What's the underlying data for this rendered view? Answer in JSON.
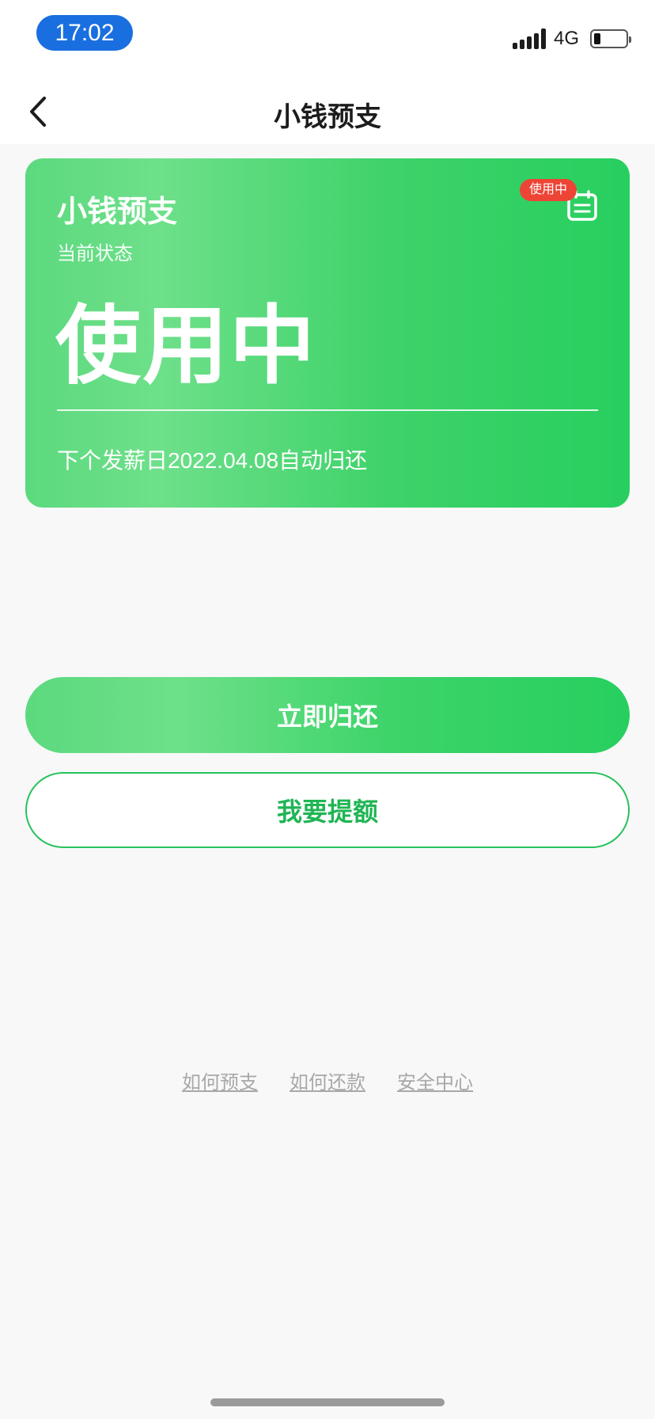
{
  "status_bar": {
    "time": "17:02",
    "network": "4G",
    "battery_level": 0.2
  },
  "nav": {
    "back_icon": "chevron-left-icon",
    "title": "小钱预支"
  },
  "card": {
    "title": "小钱预支",
    "subtitle": "当前状态",
    "status": "使用中",
    "badge": "使用中",
    "icon": "calendar-icon",
    "note": "下个发薪日2022.04.08自动归还",
    "gradient_colors": [
      "#6ee08a",
      "#27cf5f"
    ]
  },
  "actions": {
    "primary_label": "立即归还",
    "secondary_label": "我要提额"
  },
  "footer": {
    "links": [
      {
        "label": "如何预支"
      },
      {
        "label": "如何还款"
      },
      {
        "label": "安全中心"
      }
    ]
  },
  "colors": {
    "accent": "#27cf5f",
    "badge": "#ee4436",
    "time_pill": "#1a6fe0"
  }
}
